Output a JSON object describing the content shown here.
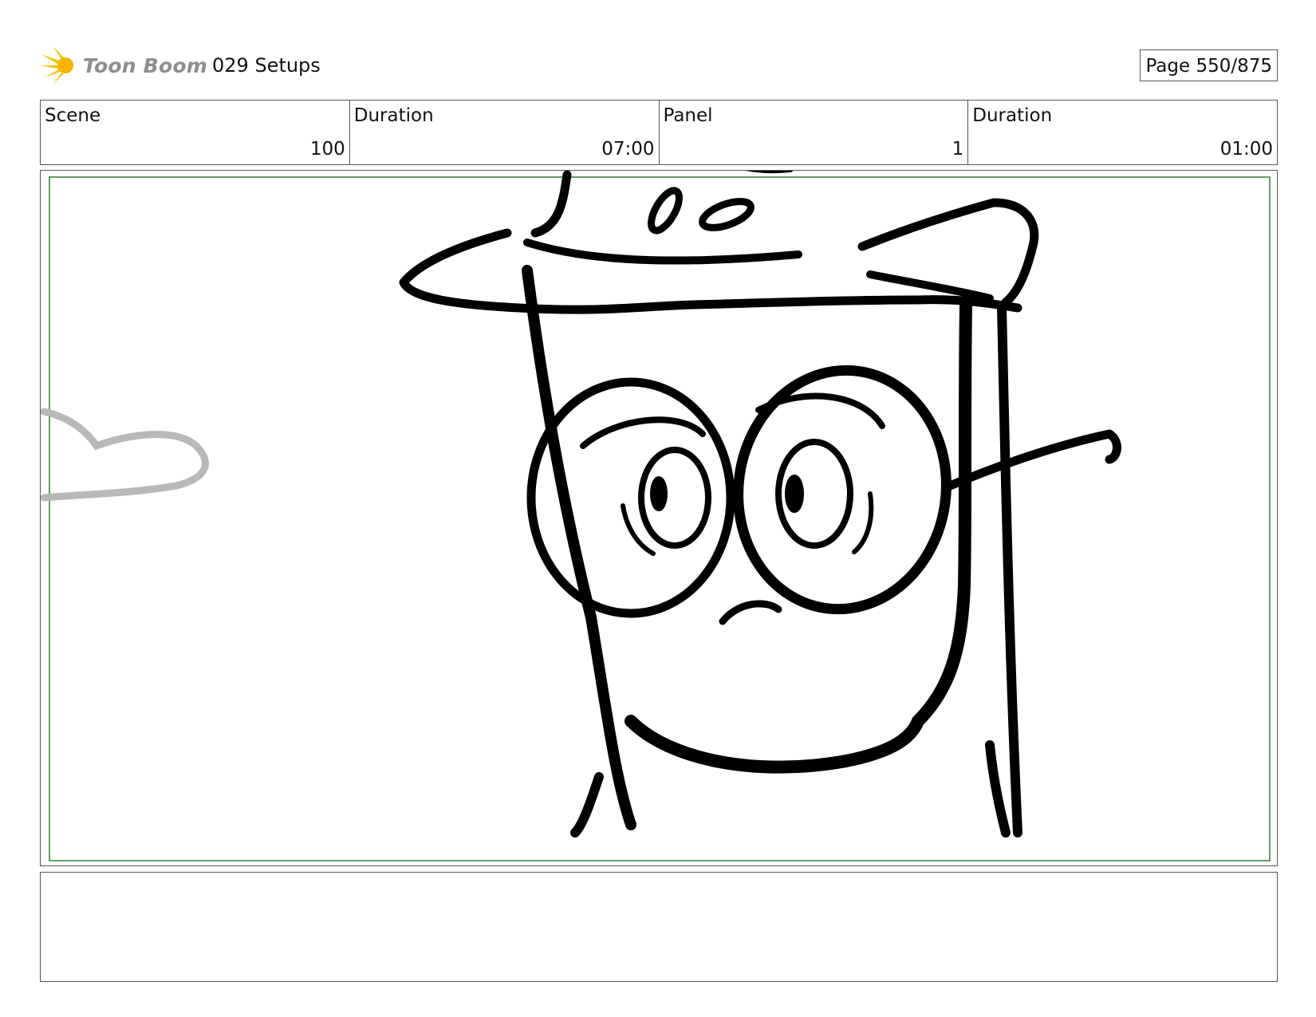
{
  "header": {
    "logo_text": "Toon Boom",
    "title": "029 Setups",
    "page": "Page 550/875"
  },
  "info": {
    "scene_label": "Scene",
    "scene_value": "100",
    "duration_label": "Duration",
    "duration_value": "07:00",
    "panel_label": "Panel",
    "panel_value": "1",
    "panel_duration_label": "Duration",
    "panel_duration_value": "01:00"
  },
  "panel": {
    "safe_frame_color": "#2e7d32"
  },
  "notes": {
    "text": ""
  }
}
